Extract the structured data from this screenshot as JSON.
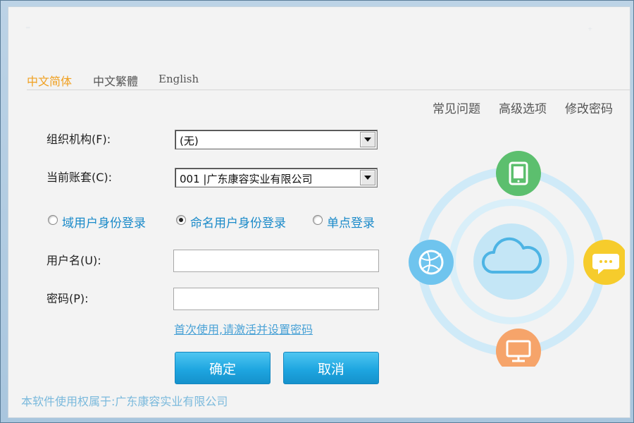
{
  "languages": [
    {
      "label": "中文简体",
      "active": true
    },
    {
      "label": "中文繁體",
      "active": false
    },
    {
      "label": "English",
      "active": false
    }
  ],
  "top_links": [
    "常见问题",
    "高级选项",
    "修改密码"
  ],
  "form": {
    "org_label": "组织机构(F):",
    "org_value": "(无)",
    "account_label": "当前账套(C):",
    "account_value": "001  |广东康容实业有限公司",
    "login_modes": [
      {
        "label": "域用户身份登录",
        "checked": false
      },
      {
        "label": "命名用户身份登录",
        "checked": true
      },
      {
        "label": "单点登录",
        "checked": false
      }
    ],
    "username_label": "用户名(U):",
    "username_value": "",
    "password_label": "密码(P):",
    "password_value": "",
    "activate_link": "首次使用,请激活并设置密码",
    "ok_label": "确定",
    "cancel_label": "取消"
  },
  "footer": "本软件使用权属于:广东康容实业有限公司",
  "illustration": {
    "center_icon": "cloud-icon",
    "satellites": [
      {
        "icon": "tablet-icon",
        "color": "#5cbf6e"
      },
      {
        "icon": "chat-bubble-icon",
        "color": "#f6cc2c"
      },
      {
        "icon": "monitor-icon",
        "color": "#f6a46a"
      },
      {
        "icon": "globe-icon",
        "color": "#6fc4ee"
      }
    ]
  }
}
